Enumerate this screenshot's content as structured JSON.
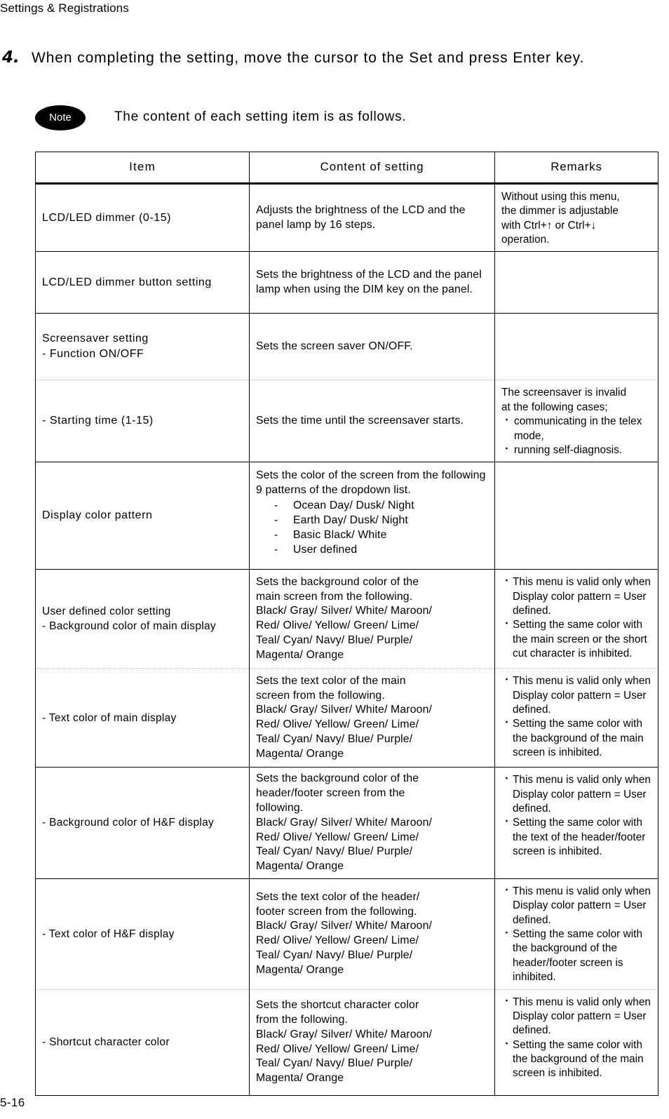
{
  "running_head": "Settings & Registrations",
  "step": {
    "number": "4.",
    "text": "When completing the setting, move the cursor to the Set and press Enter key."
  },
  "note": {
    "badge": "Note",
    "text": "The content of each setting item is as follows."
  },
  "table": {
    "headers": {
      "item": "Item",
      "content": "Content of setting",
      "remarks": "Remarks"
    },
    "rows": [
      {
        "item": "LCD/LED dimmer (0-15)",
        "content": "Adjusts the brightness of the LCD and the panel lamp by 16 steps.",
        "remarks_lines": [
          "Without using this menu,",
          "the dimmer is adjustable",
          "with Ctrl+↑ or Ctrl+↓",
          "operation."
        ]
      },
      {
        "item": "LCD/LED dimmer button setting",
        "content": "Sets the brightness of the LCD and the panel lamp when using the DIM key on the panel.",
        "remarks_lines": []
      },
      {
        "item_lines": [
          "Screensaver setting",
          "- Function ON/OFF"
        ],
        "content": "Sets the screen saver ON/OFF.",
        "remarks_lines": []
      },
      {
        "item": "- Starting time (1-15)",
        "content": "Sets the time until the screensaver starts.",
        "remarks_intro_lines": [
          "The screensaver is invalid",
          "at the following cases;"
        ],
        "remarks_bullets": [
          "communicating in the telex mode,",
          "running self-diagnosis."
        ]
      },
      {
        "item": "Display color pattern",
        "content_intro": "Sets the color of the screen from the following 9 patterns of the dropdown list.",
        "content_list": [
          "Ocean Day/ Dusk/ Night",
          "Earth Day/ Dusk/ Night",
          "Basic Black/ White",
          "User defined"
        ],
        "remarks_lines": []
      },
      {
        "item_lines": [
          "User defined color setting",
          "- Background color of main display"
        ],
        "content_lines": [
          "Sets the background color of the",
          "main screen from the following.",
          "Black/ Gray/ Silver/ White/ Maroon/",
          "Red/ Olive/ Yellow/ Green/ Lime/",
          "Teal/ Cyan/ Navy/ Blue/ Purple/",
          "Magenta/ Orange"
        ],
        "remarks_bullets": [
          "This menu is valid only when Display color pattern = User defined.",
          "Setting the same color with the main screen or the short cut character is inhibited."
        ]
      },
      {
        "item": "- Text color of main display",
        "content_lines": [
          "Sets the text color of the main",
          "screen from the following.",
          "Black/ Gray/ Silver/ White/ Maroon/",
          "Red/ Olive/ Yellow/ Green/ Lime/",
          "Teal/ Cyan/ Navy/ Blue/ Purple/",
          "Magenta/ Orange"
        ],
        "remarks_bullets": [
          "This menu is valid only when Display color pattern = User defined.",
          "Setting the same color with the background of the main screen is inhibited."
        ]
      },
      {
        "item": "- Background color of H&F display",
        "content_lines": [
          "Sets the background color of the",
          "header/footer screen from the",
          "following.",
          "Black/ Gray/ Silver/ White/ Maroon/",
          "Red/ Olive/ Yellow/ Green/ Lime/",
          "Teal/ Cyan/ Navy/ Blue/ Purple/",
          "Magenta/ Orange"
        ],
        "remarks_bullets": [
          "This menu is valid only when Display color pattern = User defined.",
          "Setting the same color with the text of the header/footer screen is inhibited."
        ]
      },
      {
        "item": "- Text color of H&F display",
        "content_lines": [
          "Sets the text color of the header/",
          "footer screen from the following.",
          "Black/ Gray/ Silver/ White/ Maroon/",
          "Red/ Olive/ Yellow/ Green/ Lime/",
          "Teal/ Cyan/ Navy/ Blue/ Purple/",
          "Magenta/ Orange"
        ],
        "remarks_bullets": [
          "This menu is valid only when Display color pattern = User defined.",
          "Setting the same color with the background of the header/footer screen is inhibited."
        ]
      },
      {
        "item": "- Shortcut character color",
        "content_lines": [
          "Sets the shortcut character color",
          "from the following.",
          "Black/ Gray/ Silver/ White/ Maroon/",
          "Red/ Olive/ Yellow/ Green/ Lime/",
          "Teal/ Cyan/ Navy/ Blue/ Purple/",
          "Magenta/ Orange"
        ],
        "remarks_bullets": [
          "This menu is valid only when Display color pattern = User defined.",
          "Setting the same color with the background of the main screen is inhibited."
        ]
      }
    ]
  },
  "folio": "5-16",
  "glyphs": {
    "dash": "-",
    "bullet": "・"
  }
}
